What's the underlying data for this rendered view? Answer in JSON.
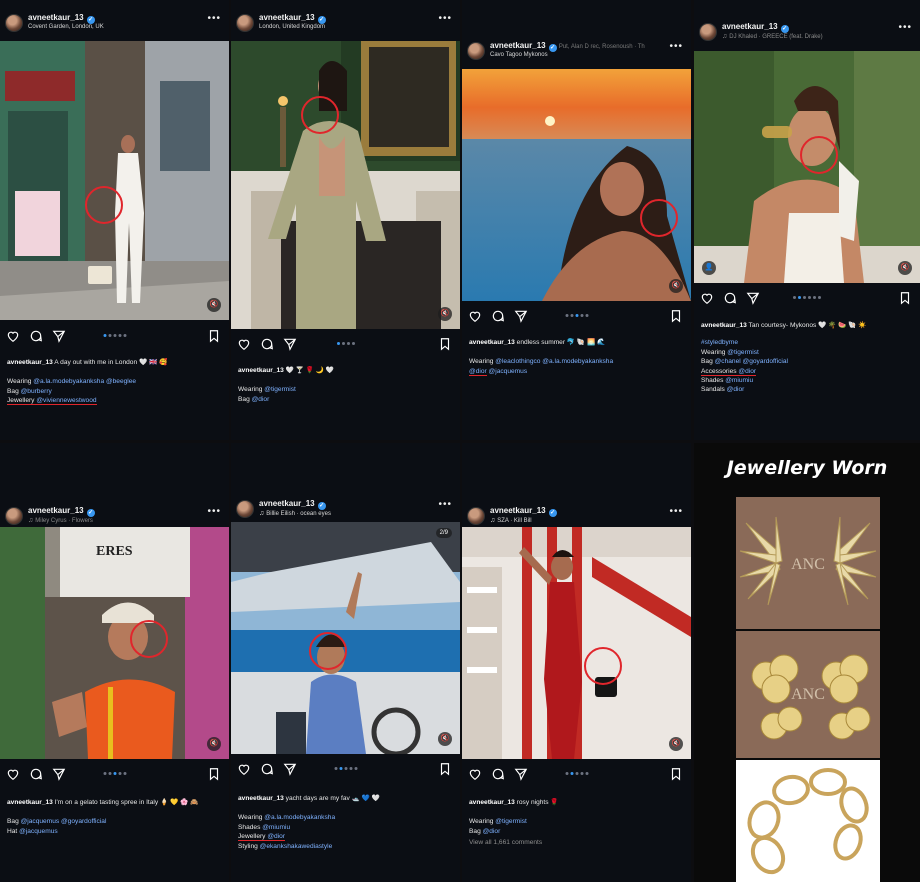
{
  "posts": [
    {
      "username": "avneetkaur_13",
      "location": "Covent Garden, London, UK",
      "caption_intro": "A day out with me in London 🤍 🇬🇧 🥰",
      "lines": [
        {
          "label": "Wearing ",
          "tags": "@a.la.modebyakanksha @beeglee"
        },
        {
          "label": "Bag ",
          "tags": "@burberry"
        },
        {
          "label": "Jewellery ",
          "tags": "@viviennewestwood",
          "highlight": true
        }
      ]
    },
    {
      "username": "avneetkaur_13",
      "location": "London, United Kingdom",
      "caption_intro": "🤍 🍸 🌹 🌙 🤍",
      "lines": [
        {
          "label": "Wearing ",
          "tags": "@tigermist"
        },
        {
          "label": "Bag ",
          "tags": "@dior"
        }
      ]
    },
    {
      "username": "avneetkaur_13",
      "location": "Cavo Tagoo Mykonos",
      "music": "Put, Alan D rec, Rosenoush · Th",
      "caption_intro": "endless summer 🐬 🐚 🌅 🌊",
      "lines": [
        {
          "label": "Wearing ",
          "tags": "@leaclothingco @a.la.modebyakanksha"
        },
        {
          "label": "",
          "tags": "@dior",
          "highlight": true,
          "extra": " @jacquemus"
        }
      ]
    },
    {
      "username": "avneetkaur_13",
      "music": "DJ Khaled · GREECE (feat. Drake)",
      "caption_intro": "Tan courtesy- Mykonos 🤍 🌴 🍉 🐚 ☀️",
      "lines": [
        {
          "label": "",
          "tags": "#styledbyme"
        },
        {
          "label": "Wearing ",
          "tags": "@tigermist"
        },
        {
          "label": "Bag ",
          "tags": "@chanel @goyardofficial"
        },
        {
          "label": "Accessories ",
          "tags": "@dior",
          "highlight": true
        },
        {
          "label": "Shades ",
          "tags": "@miumiu"
        },
        {
          "label": "Sandals ",
          "tags": "@dior"
        }
      ]
    },
    {
      "username": "avneetkaur_13",
      "music": "Miley Cyrus · Flowers",
      "caption_intro": "I'm on a gelato tasting spree in Italy 🍦 💛 🌸 🙈",
      "lines": [
        {
          "label": "Bag ",
          "tags": "@jacquemus @goyardofficial"
        },
        {
          "label": "Hat ",
          "tags": "@jacquemus"
        }
      ]
    },
    {
      "username": "avneetkaur_13",
      "music": "Billie Eilish · ocean eyes",
      "pager": "2/9",
      "caption_intro": "yacht days are my fav 🛥️ 💙 🤍",
      "lines": [
        {
          "label": "Wearing ",
          "tags": "@a.la.modebyakanksha"
        },
        {
          "label": "Shades ",
          "tags": "@miumiu"
        },
        {
          "label": "Jewellery ",
          "tags": "@dior",
          "highlight": true
        },
        {
          "label": "Styling ",
          "tags": "@ekankshakawediastyle"
        }
      ]
    },
    {
      "username": "avneetkaur_13",
      "music": "SZA · Kill Bill",
      "caption_intro": "rosy nights 🌹",
      "lines": [
        {
          "label": "Wearing ",
          "tags": "@tigermist"
        },
        {
          "label": "Bag ",
          "tags": "@dior"
        }
      ],
      "comments": "View all 1,661 comments"
    }
  ],
  "jewellery": {
    "title": "Jewellery Worn",
    "logo_text": "ANC"
  },
  "colors": {
    "accent_blue": "#3897f0",
    "tag_blue": "#7fb2ff",
    "highlight_red": "#e0262c",
    "panel_bg": "#0b0e14"
  }
}
